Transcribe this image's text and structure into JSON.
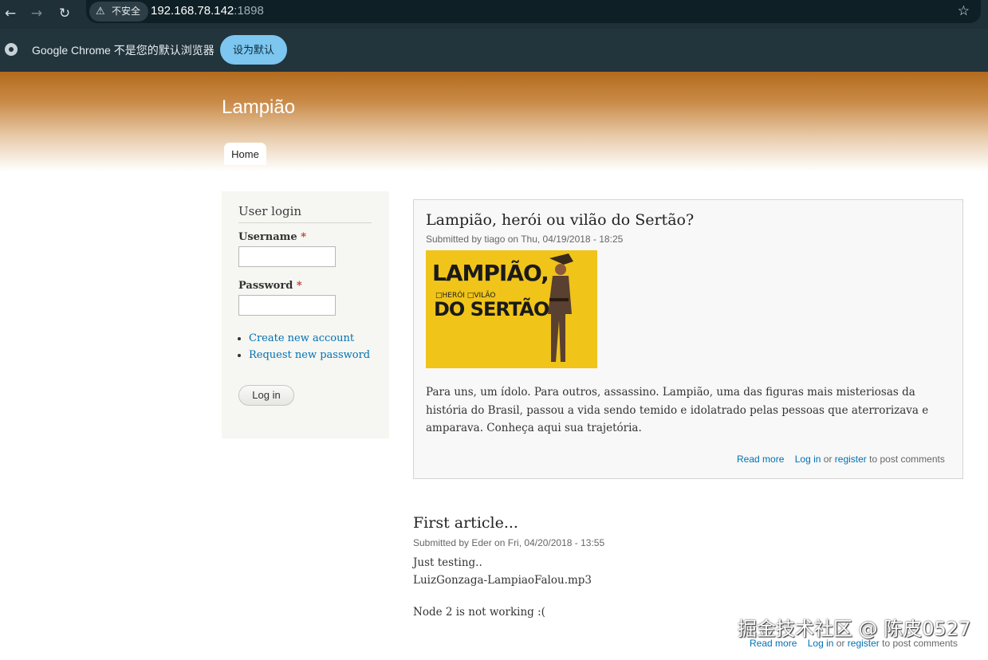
{
  "browser": {
    "security_label": "不安全",
    "url_host": "192.168.78.142",
    "url_port": ":1898"
  },
  "infobar": {
    "message": "Google Chrome 不是您的默认浏览器",
    "button": "设为默认"
  },
  "site": {
    "name": "Lampião",
    "tabs": [
      "Home"
    ]
  },
  "login_block": {
    "title": "User login",
    "username_label": "Username",
    "password_label": "Password",
    "required_mark": "*",
    "username_value": "",
    "password_value": "",
    "links": [
      "Create new account",
      "Request new password"
    ],
    "button": "Log in"
  },
  "articles": [
    {
      "title": "Lampião, herói ou vilão do Sertão?",
      "submitted": "Submitted by tiago on Thu, 04/19/2018 - 18:25",
      "image_text": {
        "line1": "LAMPIÃO,",
        "line2": "□HERÓI □VILÃO",
        "line3": "DO SERTÃO"
      },
      "body": "Para uns, um ídolo. Para outros, assassino. Lampião, uma das figuras mais misteriosas da história do Brasil, passou a vida sendo temido e idolatrado pelas pessoas que aterrorizava e amparava. Conheça aqui sua trajetória.",
      "read_more": "Read more",
      "login_link": "Log in",
      "or": "or",
      "register_link": "register",
      "post_comments": "to post comments"
    },
    {
      "title": "First article...",
      "submitted": "Submitted by Eder on Fri, 04/20/2018 - 13:55",
      "body_lines": [
        "Just testing..",
        "LuizGonzaga-LampiaoFalou.mp3",
        "Node 2 is not working :("
      ],
      "read_more": "Read more",
      "login_link": "Log in",
      "or": "or",
      "register_link": "register",
      "post_comments": "to post comments"
    }
  ],
  "watermark": "掘金技术社区 @ 陈皮0527"
}
